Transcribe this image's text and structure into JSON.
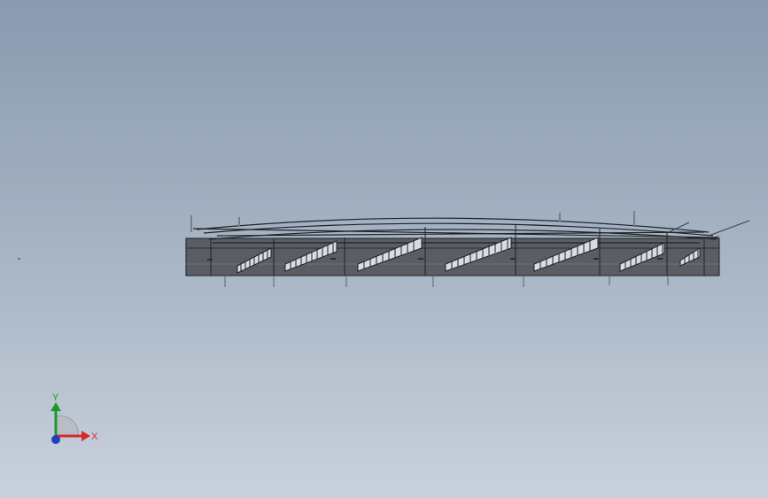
{
  "viewport": {
    "background_top": "#8a9bb0",
    "background_bottom": "#c9d1dc"
  },
  "model": {
    "icon": "cad-assembly-model",
    "line_color": "#1f2226",
    "body_color": "#55585d"
  },
  "triad": {
    "x_label": "X",
    "y_label": "Y",
    "x_color": "#d62a2a",
    "y_color": "#1a9a2a",
    "z_color": "#1f3fbf"
  }
}
